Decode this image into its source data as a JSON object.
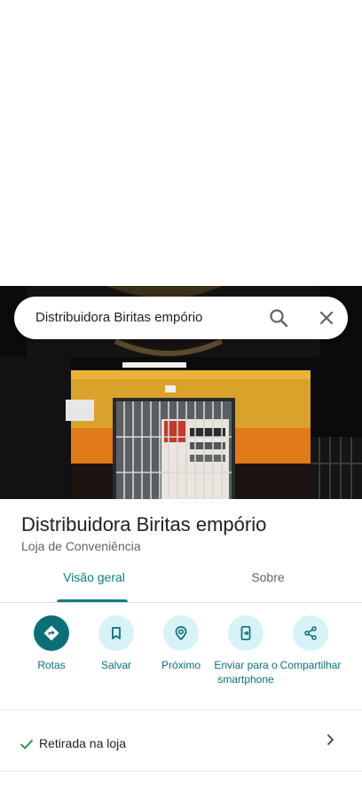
{
  "search": {
    "query": "Distribuidora Biritas empório"
  },
  "place": {
    "name": "Distribuidora Biritas empório",
    "category": "Loja de Conveniência"
  },
  "tabs": [
    {
      "label": "Visão geral",
      "active": true
    },
    {
      "label": "Sobre",
      "active": false
    }
  ],
  "actions": [
    {
      "label": "Rotas",
      "icon": "directions-icon"
    },
    {
      "label": "Salvar",
      "icon": "bookmark-icon"
    },
    {
      "label": "Próximo",
      "icon": "nearby-icon"
    },
    {
      "label": "Enviar para o smartphone",
      "icon": "send-to-phone-icon"
    },
    {
      "label": "Compartilhar",
      "icon": "share-icon"
    }
  ],
  "amenities": {
    "pickup_label": "Retirada na loja"
  },
  "colors": {
    "accent": "#0b7d84",
    "chip_bg": "#d7f3f7",
    "text": "#202124",
    "muted": "#5f6368"
  }
}
